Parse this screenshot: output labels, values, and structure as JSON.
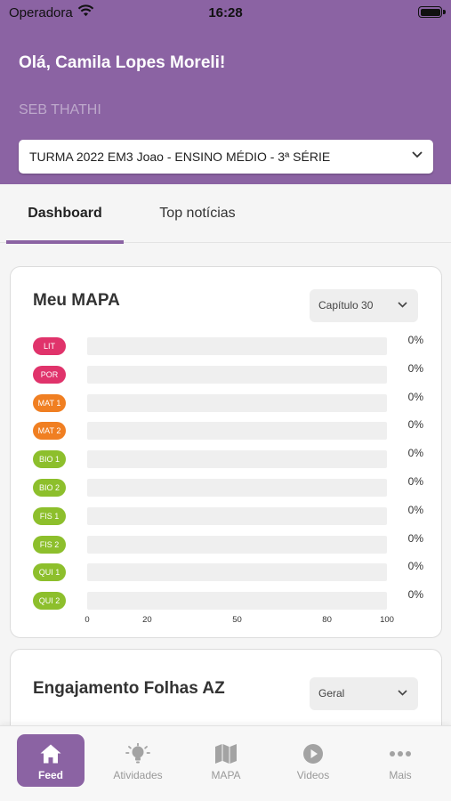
{
  "status_bar": {
    "carrier": "Operadora",
    "time": "16:28"
  },
  "header": {
    "greeting": "Olá, Camila Lopes Moreli!",
    "school": "SEB THATHI",
    "class_selector": {
      "value": "TURMA 2022 EM3 Joao - ENSINO MÉDIO - 3ª SÉRIE",
      "icon": "chevron-down-icon"
    }
  },
  "tabs": [
    {
      "label": "Dashboard",
      "active": true
    },
    {
      "label": "Top notícias",
      "active": false
    }
  ],
  "mapa_card": {
    "title": "Meu MAPA",
    "dropdown": "Capítulo 30",
    "subjects": [
      {
        "label": "LIT",
        "color": "#e0336b",
        "percent_text": "0%",
        "value": 0
      },
      {
        "label": "POR",
        "color": "#e0336b",
        "percent_text": "0%",
        "value": 0
      },
      {
        "label": "MAT 1",
        "color": "#f07f22",
        "percent_text": "0%",
        "value": 0
      },
      {
        "label": "MAT 2",
        "color": "#f07f22",
        "percent_text": "0%",
        "value": 0
      },
      {
        "label": "BIO 1",
        "color": "#8dbf2c",
        "percent_text": "0%",
        "value": 0
      },
      {
        "label": "BIO 2",
        "color": "#8dbf2c",
        "percent_text": "0%",
        "value": 0
      },
      {
        "label": "FIS 1",
        "color": "#8dbf2c",
        "percent_text": "0%",
        "value": 0
      },
      {
        "label": "FIS 2",
        "color": "#8dbf2c",
        "percent_text": "0%",
        "value": 0
      },
      {
        "label": "QUI 1",
        "color": "#8dbf2c",
        "percent_text": "0%",
        "value": 0
      },
      {
        "label": "QUI 2",
        "color": "#8dbf2c",
        "percent_text": "0%",
        "value": 0
      }
    ],
    "axis_ticks": [
      {
        "label": "0",
        "value": 0
      },
      {
        "label": "20",
        "value": 20
      },
      {
        "label": "50",
        "value": 50
      },
      {
        "label": "80",
        "value": 80
      },
      {
        "label": "100",
        "value": 100
      }
    ],
    "axis_max": 100
  },
  "engagement_card": {
    "title": "Engajamento Folhas AZ",
    "dropdown": "Geral"
  },
  "bottom_nav": [
    {
      "label": "Feed",
      "icon": "home-icon",
      "active": true
    },
    {
      "label": "Atividades",
      "icon": "lightbulb-icon",
      "active": false
    },
    {
      "label": "MAPA",
      "icon": "map-icon",
      "active": false
    },
    {
      "label": "Videos",
      "icon": "play-icon",
      "active": false
    },
    {
      "label": "Mais",
      "icon": "more-icon",
      "active": false
    }
  ],
  "colors": {
    "brand": "#8b63a3",
    "red_subject": "#e0336b",
    "orange_subject": "#f07f22",
    "green_subject": "#8dbf2c"
  }
}
